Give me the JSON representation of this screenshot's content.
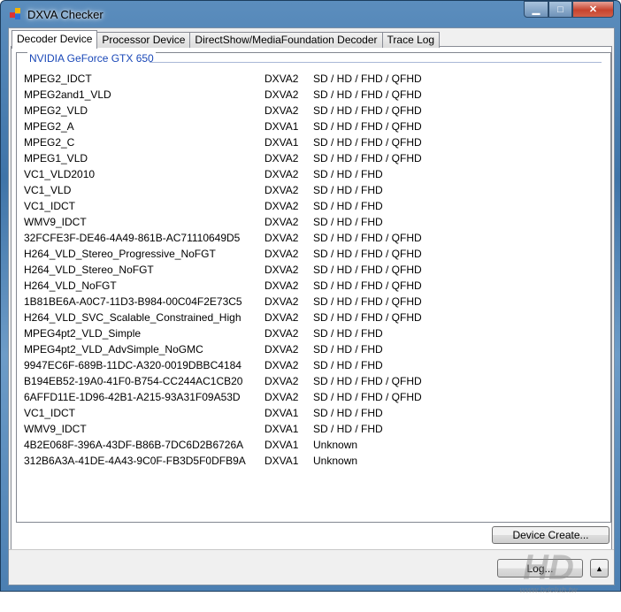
{
  "window": {
    "title": "DXVA Checker"
  },
  "tabs": [
    {
      "label": "Decoder Device"
    },
    {
      "label": "Processor Device"
    },
    {
      "label": "DirectShow/MediaFoundation Decoder"
    },
    {
      "label": "Trace Log"
    }
  ],
  "group_title": "NVIDIA GeForce GTX 650",
  "rows": [
    [
      "MPEG2_IDCT",
      "DXVA2",
      "SD / HD / FHD / QFHD"
    ],
    [
      "MPEG2and1_VLD",
      "DXVA2",
      "SD / HD / FHD / QFHD"
    ],
    [
      "MPEG2_VLD",
      "DXVA2",
      "SD / HD / FHD / QFHD"
    ],
    [
      "MPEG2_A",
      "DXVA1",
      "SD / HD / FHD / QFHD"
    ],
    [
      "MPEG2_C",
      "DXVA1",
      "SD / HD / FHD / QFHD"
    ],
    [
      "MPEG1_VLD",
      "DXVA2",
      "SD / HD / FHD / QFHD"
    ],
    [
      "VC1_VLD2010",
      "DXVA2",
      "SD / HD / FHD"
    ],
    [
      "VC1_VLD",
      "DXVA2",
      "SD / HD / FHD"
    ],
    [
      "VC1_IDCT",
      "DXVA2",
      "SD / HD / FHD"
    ],
    [
      "WMV9_IDCT",
      "DXVA2",
      "SD / HD / FHD"
    ],
    [
      "32FCFE3F-DE46-4A49-861B-AC71110649D5",
      "DXVA2",
      "SD / HD / FHD / QFHD"
    ],
    [
      "H264_VLD_Stereo_Progressive_NoFGT",
      "DXVA2",
      "SD / HD / FHD / QFHD"
    ],
    [
      "H264_VLD_Stereo_NoFGT",
      "DXVA2",
      "SD / HD / FHD / QFHD"
    ],
    [
      "H264_VLD_NoFGT",
      "DXVA2",
      "SD / HD / FHD / QFHD"
    ],
    [
      "1B81BE6A-A0C7-11D3-B984-00C04F2E73C5",
      "DXVA2",
      "SD / HD / FHD / QFHD"
    ],
    [
      "H264_VLD_SVC_Scalable_Constrained_High",
      "DXVA2",
      "SD / HD / FHD / QFHD"
    ],
    [
      "MPEG4pt2_VLD_Simple",
      "DXVA2",
      "SD / HD / FHD"
    ],
    [
      "MPEG4pt2_VLD_AdvSimple_NoGMC",
      "DXVA2",
      "SD / HD / FHD"
    ],
    [
      "9947EC6F-689B-11DC-A320-0019DBBC4184",
      "DXVA2",
      "SD / HD / FHD"
    ],
    [
      "B194EB52-19A0-41F0-B754-CC244AC1CB20",
      "DXVA2",
      "SD / HD / FHD / QFHD"
    ],
    [
      "6AFFD11E-1D96-42B1-A215-93A31F09A53D",
      "DXVA2",
      "SD / HD / FHD / QFHD"
    ],
    [
      "VC1_IDCT",
      "DXVA1",
      "SD / HD / FHD"
    ],
    [
      "WMV9_IDCT",
      "DXVA1",
      "SD / HD / FHD"
    ],
    [
      "4B2E068F-396A-43DF-B86B-7DC6D2B6726A",
      "DXVA1",
      "Unknown"
    ],
    [
      "312B6A3A-41DE-4A43-9C0F-FB3D5F0DFB9A",
      "DXVA1",
      "Unknown"
    ]
  ],
  "buttons": {
    "device_create": "Device Create...",
    "log": "Log...",
    "up": "▲"
  },
  "watermark": "HD CLUB www.hdclub.tw",
  "colors": {
    "group_title": "#1a48b8",
    "close": "#c7442e"
  }
}
